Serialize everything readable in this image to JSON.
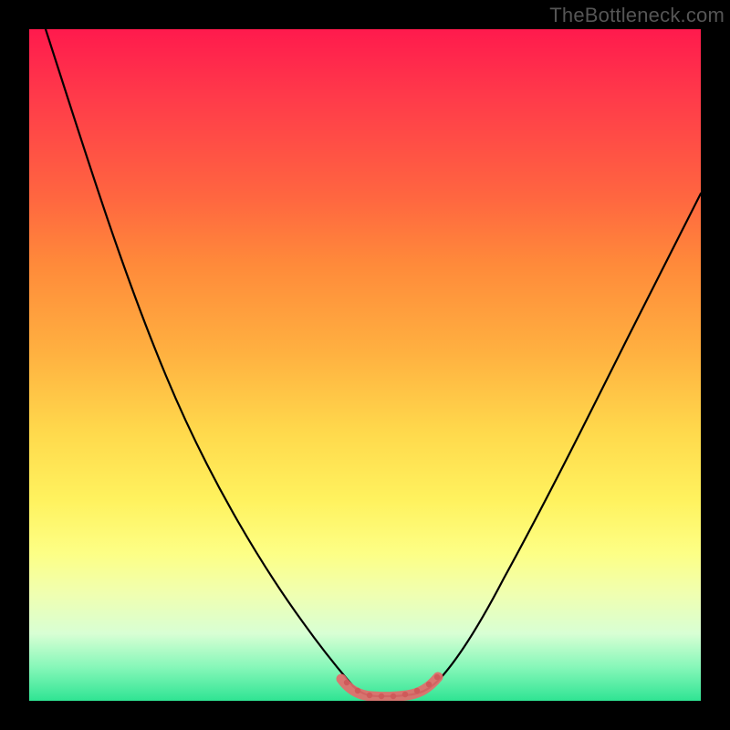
{
  "watermark": "TheBottleneck.com",
  "colors": {
    "background": "#000000",
    "gradient_top": "#ff1a4d",
    "gradient_mid": "#ffd94c",
    "gradient_bottom": "#2fe493",
    "curve": "#000000",
    "highlight": "#e46b6b"
  },
  "chart_data": {
    "type": "line",
    "title": "",
    "xlabel": "",
    "ylabel": "",
    "x": [
      0.0,
      0.05,
      0.1,
      0.15,
      0.2,
      0.25,
      0.3,
      0.35,
      0.4,
      0.45,
      0.475,
      0.5,
      0.525,
      0.55,
      0.575,
      0.6,
      0.65,
      0.7,
      0.75,
      0.8,
      0.85,
      0.9,
      0.95,
      1.0
    ],
    "values": [
      1.0,
      0.9,
      0.8,
      0.7,
      0.6,
      0.5,
      0.4,
      0.285,
      0.17,
      0.075,
      0.035,
      0.015,
      0.005,
      0.002,
      0.005,
      0.018,
      0.065,
      0.13,
      0.21,
      0.3,
      0.39,
      0.48,
      0.56,
      0.66
    ],
    "xlim": [
      0,
      1
    ],
    "ylim": [
      0,
      1
    ],
    "highlight_range": [
      0.46,
      0.6
    ],
    "legend": false,
    "grid": false
  }
}
